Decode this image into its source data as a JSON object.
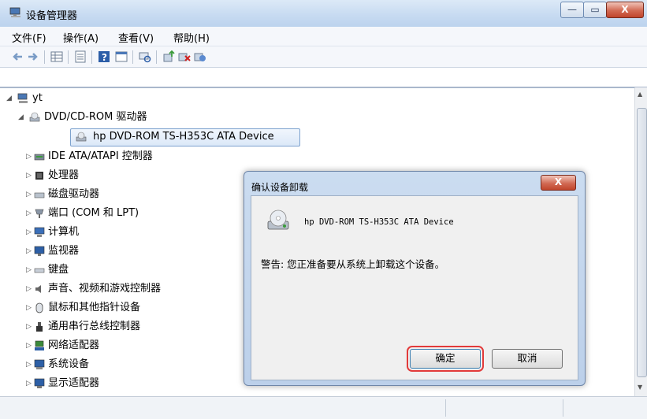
{
  "window": {
    "title": "设备管理器",
    "controls": [
      "—",
      "▭",
      "X"
    ]
  },
  "menu": [
    "文件(F)",
    "操作(A)",
    "查看(V)",
    "帮助(H)"
  ],
  "tree": {
    "root": "yt",
    "items": [
      {
        "label": "DVD/CD-ROM 驱动器",
        "expanded": true,
        "icon": "dvd-drive-icon"
      },
      {
        "label": "hp DVD-ROM TS-H353C ATA Device",
        "child": true,
        "selected": true,
        "icon": "dvd-drive-icon"
      },
      {
        "label": "IDE ATA/ATAPI 控制器",
        "icon": "ide-controller-icon"
      },
      {
        "label": "处理器",
        "icon": "processor-icon"
      },
      {
        "label": "磁盘驱动器",
        "icon": "disk-drive-icon"
      },
      {
        "label": "端口 (COM 和 LPT)",
        "icon": "port-icon"
      },
      {
        "label": "计算机",
        "icon": "computer-icon"
      },
      {
        "label": "监视器",
        "icon": "monitor-icon"
      },
      {
        "label": "键盘",
        "icon": "keyboard-icon"
      },
      {
        "label": "声音、视频和游戏控制器",
        "icon": "speaker-icon"
      },
      {
        "label": "鼠标和其他指针设备",
        "icon": "mouse-icon"
      },
      {
        "label": "通用串行总线控制器",
        "icon": "usb-icon"
      },
      {
        "label": "网络适配器",
        "icon": "network-icon"
      },
      {
        "label": "系统设备",
        "icon": "system-device-icon"
      },
      {
        "label": "显示适配器",
        "icon": "display-adapter-icon"
      }
    ]
  },
  "dialog": {
    "title": "确认设备卸载",
    "close": "X",
    "device": "hp DVD-ROM TS-H353C ATA Device",
    "warning": "警告: 您正准备要从系统上卸载这个设备。",
    "ok": "确定",
    "cancel": "取消"
  },
  "colors": {
    "accent": "#3a6ea5",
    "highlight": "#e23a3a"
  }
}
